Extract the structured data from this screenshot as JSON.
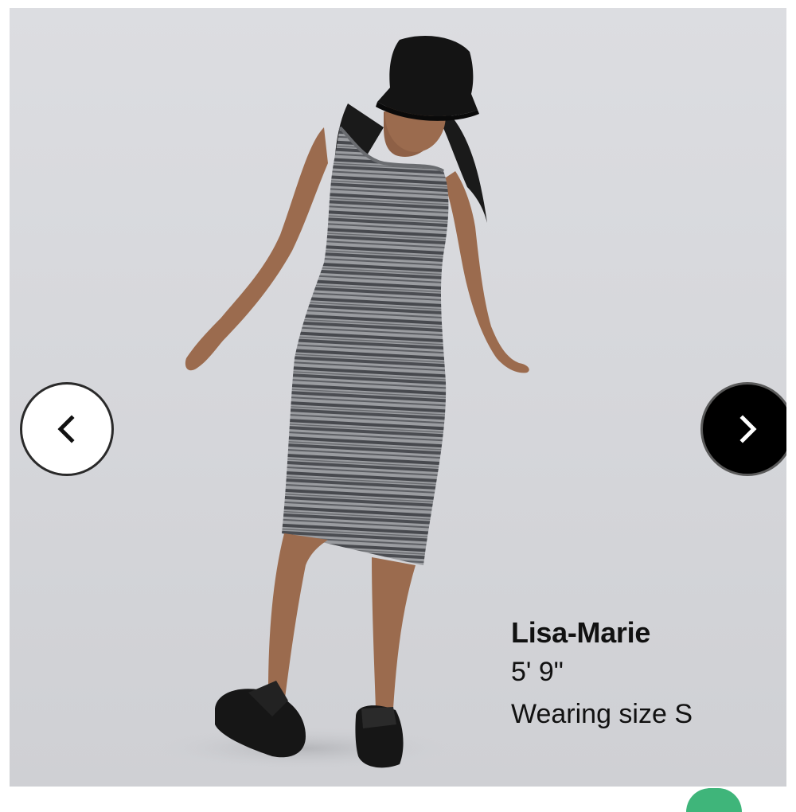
{
  "gallery": {
    "image_alt": "Model wearing a striped grey sleeveless midi dress, black bucket hat and black sandals",
    "prev_icon": "chevron-left-icon",
    "next_icon": "chevron-right-icon"
  },
  "model_info": {
    "name": "Lisa-Marie",
    "height": "5' 9\"",
    "size_note": "Wearing size S"
  },
  "colors": {
    "background": "#d8d9dd",
    "prev_button_bg": "#ffffff",
    "next_button_bg": "#000000",
    "dress": "#8d8f93",
    "accent_badge": "#3fb57a"
  }
}
